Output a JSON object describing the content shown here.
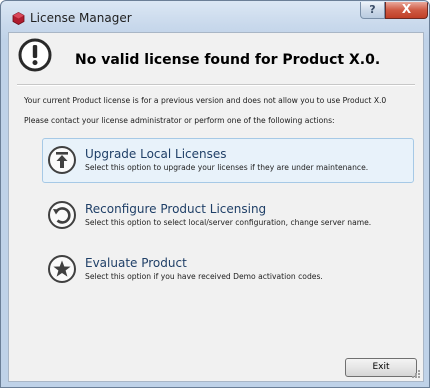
{
  "window": {
    "title": "License Manager",
    "help_label": "?",
    "close_label": "X"
  },
  "header": {
    "title": "No valid license found for Product X.0."
  },
  "messages": [
    "Your current Product license is for a previous version and does not allow you to use Product X.0",
    "Please contact your license administrator or perform one of the following actions:"
  ],
  "options": [
    {
      "icon": "upgrade-icon",
      "title": "Upgrade Local Licenses",
      "description": "Select this option to upgrade your licenses if they are under maintenance."
    },
    {
      "icon": "reconfigure-icon",
      "title": "Reconfigure Product Licensing",
      "description": "Select this option to select local/server configuration, change server name."
    },
    {
      "icon": "star-icon",
      "title": "Evaluate Product",
      "description": "Select this option if you have received Demo activation codes."
    }
  ],
  "footer": {
    "exit_label": "Exit"
  },
  "colors": {
    "option_title": "#1f3f67",
    "hover_background": "#e8f2fa",
    "hover_border": "#a6c9e6",
    "app_icon": "#b01c2e"
  }
}
